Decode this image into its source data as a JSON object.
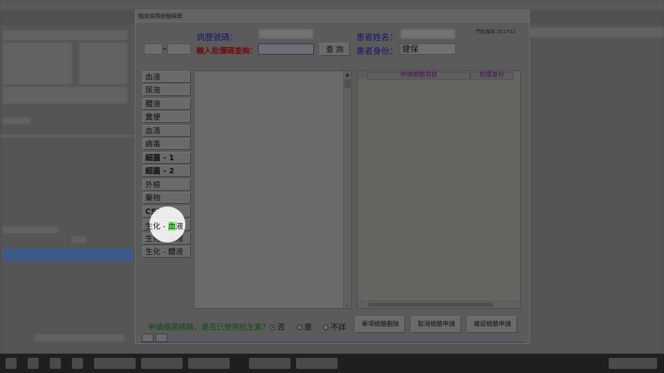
{
  "dialog": {
    "title": "臨床病理檢驗開單",
    "version": "門診版本 201702"
  },
  "header": {
    "chart_no_label": "病歷號碼：",
    "batch_query_label": "輸入批價碼查詢：",
    "query_button": "查 詢",
    "patient_name_label": "患者姓名：",
    "patient_status_label": "患者身份：",
    "patient_status_value": "健保"
  },
  "categories": [
    "血液",
    "尿液",
    "體液",
    "糞便",
    "血清",
    "病毒",
    "細菌 - 1",
    "細菌 - 2",
    "外檢",
    "藥物",
    "CSF",
    "生化 - 血液",
    "生化 - 尿液",
    "生化 - 體液"
  ],
  "highlighted_category": {
    "prefix": "生化 - ",
    "highlight": "血",
    "suffix": "液"
  },
  "grid": {
    "columns": [
      "申請檢驗項目",
      "批價身份"
    ]
  },
  "footer": {
    "question": "申請細菌檢驗，是否已使用抗生素？",
    "options": [
      "否",
      "是",
      "不詳"
    ],
    "selected_option": "否",
    "buttons": [
      "單項檢驗刪除",
      "取消檢驗申請",
      "確認檢驗申請"
    ]
  }
}
